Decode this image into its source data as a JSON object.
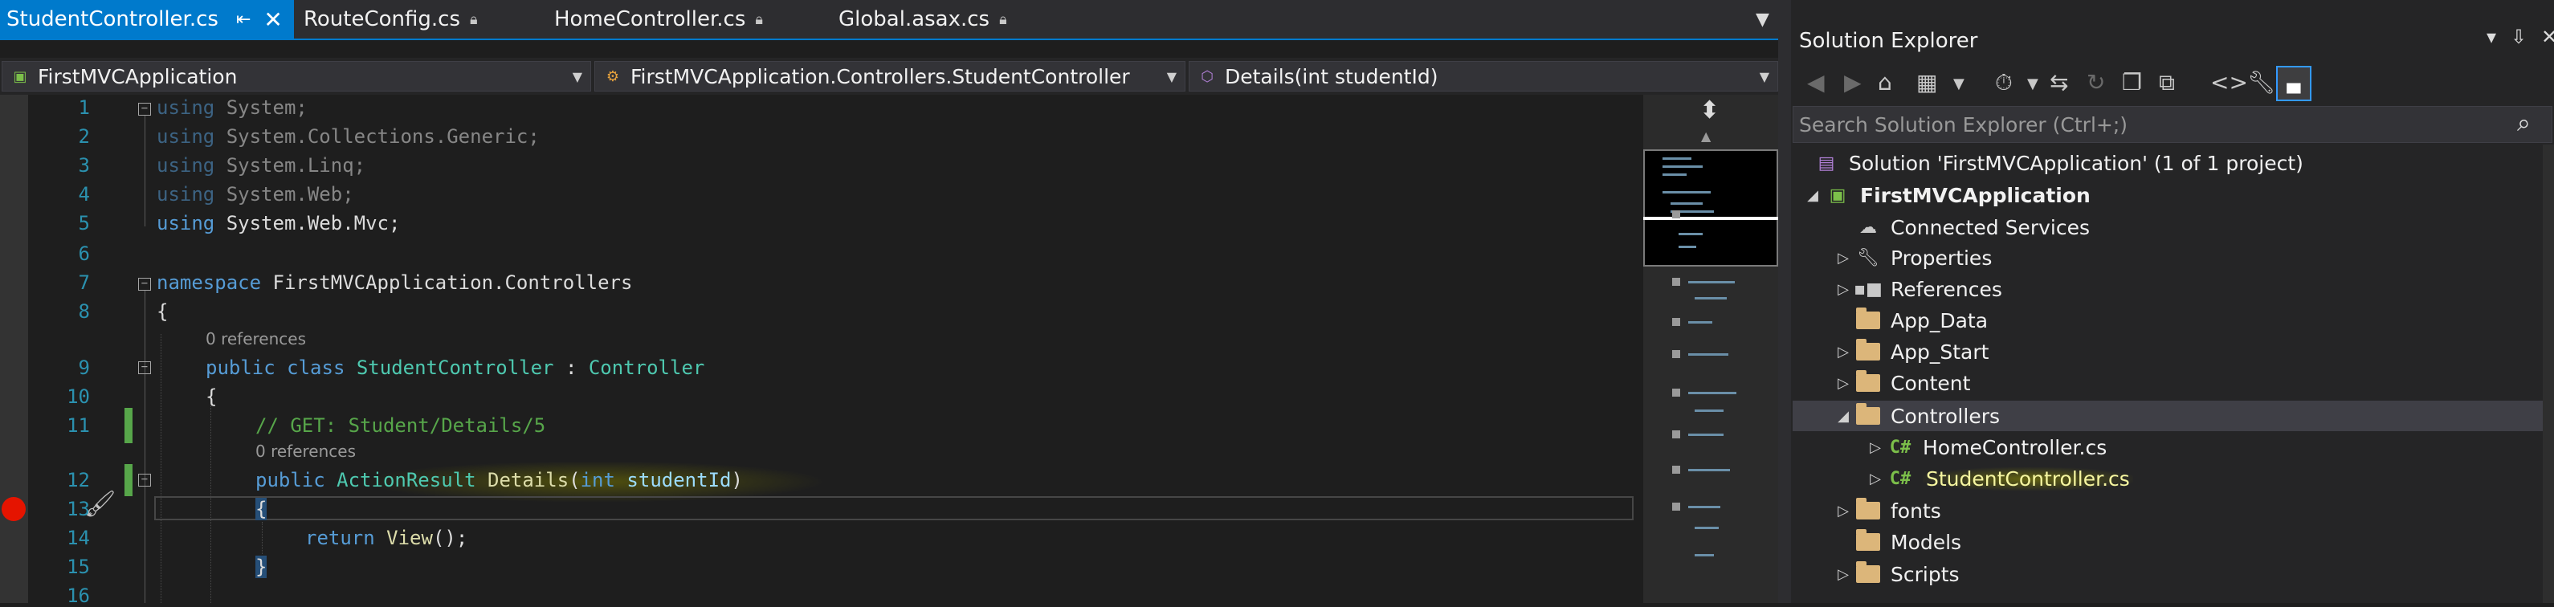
{
  "tabs": [
    {
      "label": "StudentController.cs",
      "active": true,
      "pinned": true,
      "closable": true
    },
    {
      "label": "RouteConfig.cs",
      "locked": true
    },
    {
      "label": "HomeController.cs",
      "locked": true
    },
    {
      "label": "Global.asax.cs",
      "locked": true
    }
  ],
  "navbar": {
    "project": "FirstMVCApplication",
    "type": "FirstMVCApplication.Controllers.StudentController",
    "member": "Details(int studentId)"
  },
  "editor": {
    "line_numbers": [
      "1",
      "2",
      "3",
      "4",
      "5",
      "6",
      "7",
      "8",
      "9",
      "10",
      "11",
      "12",
      "13",
      "14",
      "15",
      "16"
    ],
    "lines": {
      "l1": {
        "kw": "using",
        "rest": " System;"
      },
      "l2": {
        "kw": "using",
        "rest": " System.Collections.Generic;"
      },
      "l3": {
        "kw": "using",
        "rest": " System.Linq;"
      },
      "l4": {
        "kw": "using",
        "rest": " System.Web;"
      },
      "l5": {
        "kw": "using",
        "rest": " System.Web.Mvc;"
      },
      "l7": {
        "kw": "namespace",
        "rest": " FirstMVCApplication.Controllers"
      },
      "l8": "{",
      "ref9": "0 references",
      "l9": {
        "kw1": "public",
        "kw2": "class",
        "name": "StudentController",
        "colon": " : ",
        "base": "Controller"
      },
      "l10": "{",
      "l11": "// GET: Student/Details/5",
      "ref12": "0 references",
      "l12": {
        "kw": "public",
        "type": "ActionResult",
        "method": "Details",
        "open": "(",
        "ptype": "int",
        "pname": "studentId",
        "close": ")"
      },
      "l13": "{",
      "l14": {
        "kw": "return",
        "call": "View",
        "rest": "();"
      },
      "l15": "}"
    }
  },
  "solution_explorer": {
    "title": "Solution Explorer",
    "search_placeholder": "Search Solution Explorer (Ctrl+;)",
    "solution": "Solution 'FirstMVCApplication' (1 of 1 project)",
    "project": "FirstMVCApplication",
    "items": [
      {
        "label": "Connected Services"
      },
      {
        "label": "Properties"
      },
      {
        "label": "References"
      },
      {
        "label": "App_Data"
      },
      {
        "label": "App_Start"
      },
      {
        "label": "Content"
      },
      {
        "label": "Controllers"
      },
      {
        "label": "HomeController.cs"
      },
      {
        "label": "StudentController.cs"
      },
      {
        "label": "fonts"
      },
      {
        "label": "Models"
      },
      {
        "label": "Scripts"
      }
    ]
  },
  "colors": {
    "accent": "#007acc",
    "keyword": "#569cd6",
    "type": "#4ec9b0",
    "comment": "#57a64a",
    "breakpoint": "#e51400",
    "folder": "#dcb67a"
  }
}
